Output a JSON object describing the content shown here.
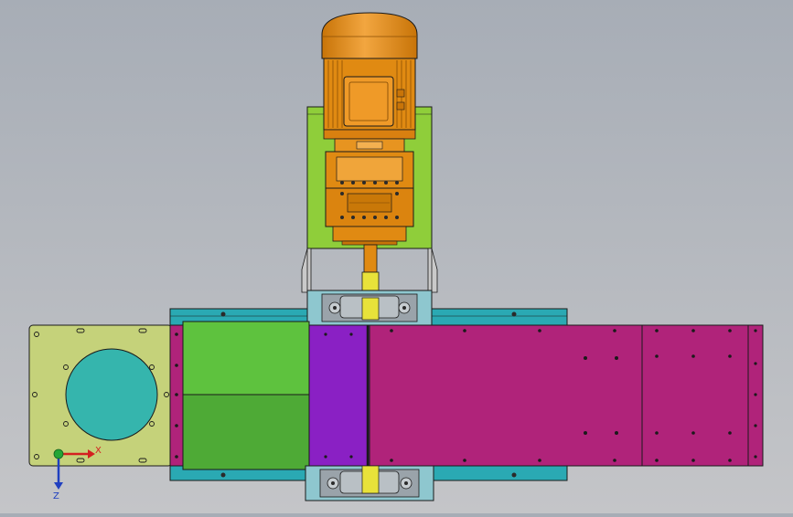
{
  "viewport": {
    "name": "cad-viewport",
    "background_top": "#a7adb6",
    "background_bottom": "#c4c5c8"
  },
  "triad": {
    "x_label": "X",
    "z_label": "Z",
    "x_color": "#d42020",
    "z_color": "#1f3fc0",
    "y_color": "#23a636"
  },
  "colors": {
    "outline": "#1a1a1a",
    "motor_orange": "#e08a12",
    "motor_light": "#f0a53a",
    "motor_dark": "#b86a08",
    "bracket_green": "#8fce3a",
    "shaft_yellow": "#e8e23a",
    "bearing_cyan": "#8ec7cf",
    "bearing_gray": "#9aa3aa",
    "rail_teal": "#2aa9b3",
    "flange_olive": "#c5d27a",
    "port_teal": "#35b5ad",
    "box_green_top": "#5ec23e",
    "box_green_bottom": "#4eaa36",
    "purple": "#8a20c4",
    "magenta": "#b0237a",
    "hole": "#2a2a2a"
  }
}
